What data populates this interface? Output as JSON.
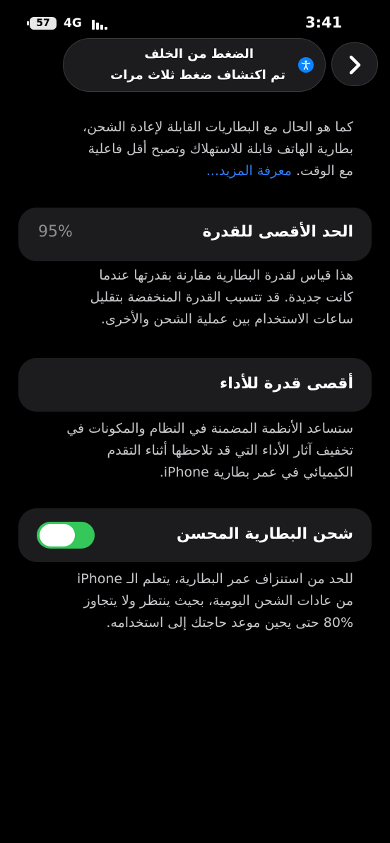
{
  "status_bar": {
    "battery_level": "57",
    "network": "4G",
    "time": "3:41"
  },
  "back_tap": {
    "title": "الضغط من الخلف",
    "subtitle": "تم اكتشاف ضغط ثلاث مرات",
    "icon": "accessibility-icon",
    "chevron": "chevron-right-icon"
  },
  "intro": {
    "lines": [
      "كما هو الحال مع البطاريات القابلة لإعادة الشحن،",
      "بطارية الهاتف قابلة للاستهلاك وتصبح أقل فاعلية",
      "مع الوقت."
    ],
    "learn_more": "معرفة المزيد..."
  },
  "maximum_capacity": {
    "label": "الحد الأقصى للقدرة",
    "value": "95%",
    "value_fraction": 0.95,
    "description": [
      "هذا قياس لقدرة البطارية مقارنة بقدرتها عندما",
      "كانت جديدة. قد تتسبب القدرة المنخفضة بتقليل",
      "ساعات الاستخدام بين عملية الشحن والأخرى."
    ]
  },
  "peak_performance": {
    "label": "أقصى قدرة للأداء",
    "description": [
      "ستساعد الأنظمة المضمنة في النظام والمكونات في",
      "تخفيف آثار الأداء التي قد تلاحظها أثناء التقدم",
      "الكيميائي في عمر بطارية iPhone."
    ]
  },
  "optimized_charging": {
    "label": "شحن البطارية المحسن",
    "enabled": true,
    "toggle_color": "#34c759",
    "description": [
      "للحد من استنزاف عمر البطارية، يتعلم الـ iPhone",
      "من عادات الشحن اليومية، بحيث ينتظر ولا يتجاوز",
      "80% حتى يحين موعد حاجتك إلى استخدامه."
    ]
  },
  "colors": {
    "background": "#000000",
    "card": "#1c1c1e",
    "link": "#2f7fff",
    "accent": "#0a84ff"
  }
}
